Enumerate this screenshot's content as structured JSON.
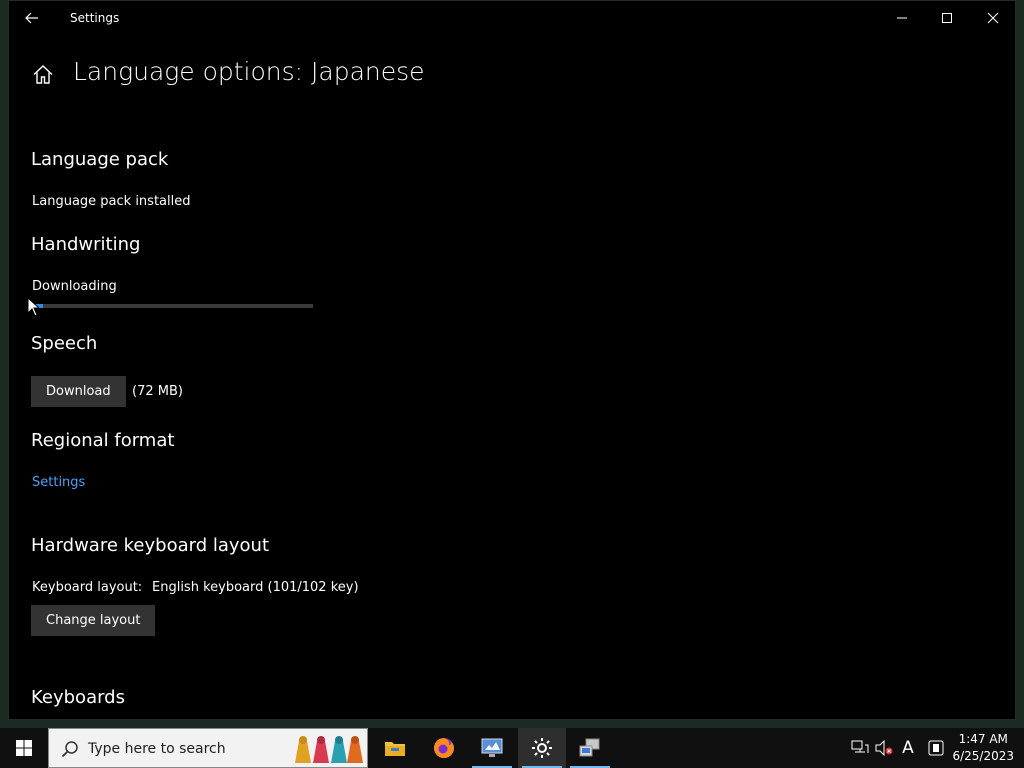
{
  "window": {
    "title": "Settings",
    "page_title": "Language options: Japanese"
  },
  "sections": {
    "language_pack": {
      "heading": "Language pack",
      "status": "Language pack installed"
    },
    "handwriting": {
      "heading": "Handwriting",
      "status": "Downloading",
      "progress_percent": 4
    },
    "speech": {
      "heading": "Speech",
      "button_label": "Download",
      "size": "(72 MB)"
    },
    "regional_format": {
      "heading": "Regional format",
      "link": "Settings"
    },
    "hardware_keyboard": {
      "heading": "Hardware keyboard layout",
      "layout_label": "Keyboard layout:",
      "layout_value": "English keyboard (101/102 key)",
      "button_label": "Change layout"
    },
    "keyboards": {
      "heading": "Keyboards"
    }
  },
  "taskbar": {
    "search_placeholder": "Type here to search",
    "apps": [
      "file-explorer-icon",
      "firefox-icon",
      "control-panel-icon",
      "settings-gear-icon",
      "network-computer-icon"
    ],
    "tray": {
      "ime_indicator": "A"
    },
    "clock": {
      "time": "1:47 AM",
      "date": "6/25/2023"
    }
  },
  "colors": {
    "link": "#4ea1f3",
    "progress": "#2f8ae6",
    "active_underline": "#76b9ed"
  }
}
